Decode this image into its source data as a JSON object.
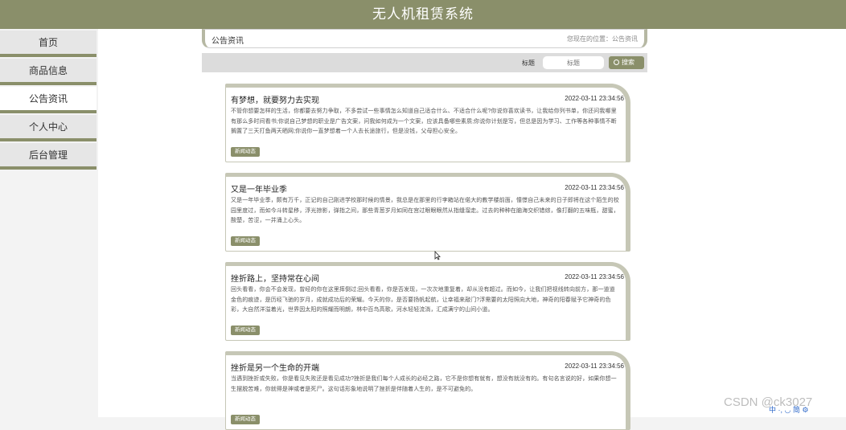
{
  "header": {
    "title": "无人机租赁系统"
  },
  "sidebar": {
    "items": [
      {
        "label": "首页"
      },
      {
        "label": "商品信息"
      },
      {
        "label": "公告资讯",
        "active": true
      },
      {
        "label": "个人中心"
      },
      {
        "label": "后台管理"
      }
    ]
  },
  "breadcrumb": {
    "title": "公告资讯",
    "location": "您现在的位置：公告资讯"
  },
  "search": {
    "label": "标题",
    "placeholder": "标题",
    "button_label": "搜索"
  },
  "cards": [
    {
      "title": "有梦想，就要努力去实现",
      "time": "2022-03-11 23:34:56",
      "body": "不管你想要怎样的生活，你都要去努力争取，不多尝试一些事情怎么知道自己适合什么、不适合什么呢?你说你喜欢读书，让我给你列书单，你还问我哪里有那么多时间看书;你说自己梦想的职业是广告文案，问我如何成为一个文案，应该具备哪些素质;你说你计划是写，但总是因为学习、工作等各种事情不断搁置了三天打鱼两天晒网;你说你一直梦想着一个人去长途旅行，但是没钱，父母担心安全。",
      "tag": "新闻动态"
    },
    {
      "title": "又是一年毕业季",
      "time": "2022-03-11 23:34:56",
      "body": "又是一年毕业季，颇有万千，正记的自己刚进学校那时候的情景，我总是在那里的行李箱站在偌大的教学楼前面，憧憬自己未来的日子即将在这个陌生的校园里度过，而如今斗转星移，浮光掠影，弹指之间，那些青葱岁月如同在宫过眼眼眼然从指缝溜走。过去的种种在脑海交织错综，像打翻的五味瓶，甜蜜，酸楚，苦涩，一并涌上心头。",
      "tag": "新闻动态"
    },
    {
      "title": "挫折路上，坚持常在心间",
      "time": "2022-03-11 23:34:56",
      "body": "回头看看，你会不会发现，曾经的你在这里摔倒过;回头看看，你是否发现，一次次地重复着，却从没有超过。而如今，让我们把视线转向前方，那一道道金色的痕迹，是历经飞驰的岁月，成就成功后的荣耀。今天的你，是否要扬帆起航，让幸福来敲门?浮需要的太阳照向大地，神奇的阳春赋予它神奇的色彩，大自然洋溢着光，世界因太阳的照耀而明朗，林中百鸟高歌，河水轻轻流淌，汇成满宁的山间小道。",
      "tag": "新闻动态"
    },
    {
      "title": "挫折是另一个生命的开端",
      "time": "2022-03-11 23:34:56",
      "body": "当遇到挫折或失败，你是看见失败还是看见成功?挫折是我们每个人成长的必经之路，它不是你想有就有，想没有就没有的。有句名言说的好，如果你想一生摆脱苦难，你就得是神或者是死尸。这句话形象地说明了挫折是伴随着人生的，是不可避免的。",
      "tag": "新闻动态"
    }
  ],
  "watermark": "CSDN @ck3027",
  "tray": "中 ·, ◡ 简 ⚙"
}
